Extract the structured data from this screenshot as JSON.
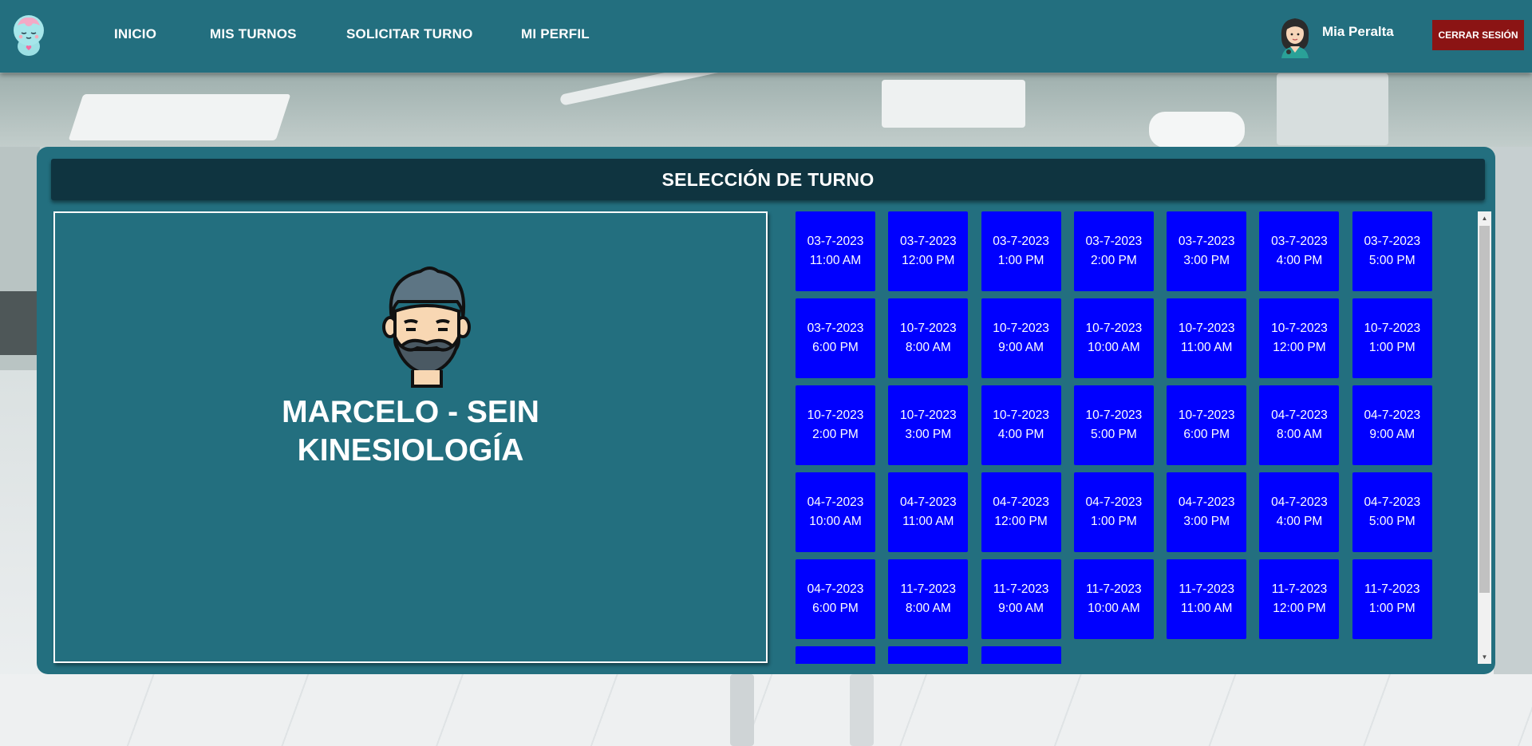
{
  "nav": {
    "links": [
      "INICIO",
      "MIS TURNOS",
      "SOLICITAR TURNO",
      "MI PERFIL"
    ],
    "user_name": "Mia Peralta",
    "logout_label": "CERRAR SESIÓN",
    "logo_icon": "brain-mascot-icon",
    "user_icon": "woman-avatar-icon"
  },
  "card": {
    "title": "SELECCIÓN DE TURNO",
    "doctor": {
      "name": "MARCELO - SEIN",
      "specialty": "KINESIOLOGÍA",
      "avatar_icon": "bearded-man-avatar-icon"
    },
    "slots": [
      {
        "date": "03-7-2023",
        "time": "11:00 AM"
      },
      {
        "date": "03-7-2023",
        "time": "12:00 PM"
      },
      {
        "date": "03-7-2023",
        "time": "1:00 PM"
      },
      {
        "date": "03-7-2023",
        "time": "2:00 PM"
      },
      {
        "date": "03-7-2023",
        "time": "3:00 PM"
      },
      {
        "date": "03-7-2023",
        "time": "4:00 PM"
      },
      {
        "date": "03-7-2023",
        "time": "5:00 PM"
      },
      {
        "date": "03-7-2023",
        "time": "6:00 PM"
      },
      {
        "date": "10-7-2023",
        "time": "8:00 AM"
      },
      {
        "date": "10-7-2023",
        "time": "9:00 AM"
      },
      {
        "date": "10-7-2023",
        "time": "10:00 AM"
      },
      {
        "date": "10-7-2023",
        "time": "11:00 AM"
      },
      {
        "date": "10-7-2023",
        "time": "12:00 PM"
      },
      {
        "date": "10-7-2023",
        "time": "1:00 PM"
      },
      {
        "date": "10-7-2023",
        "time": "2:00 PM"
      },
      {
        "date": "10-7-2023",
        "time": "3:00 PM"
      },
      {
        "date": "10-7-2023",
        "time": "4:00 PM"
      },
      {
        "date": "10-7-2023",
        "time": "5:00 PM"
      },
      {
        "date": "10-7-2023",
        "time": "6:00 PM"
      },
      {
        "date": "04-7-2023",
        "time": "8:00 AM"
      },
      {
        "date": "04-7-2023",
        "time": "9:00 AM"
      },
      {
        "date": "04-7-2023",
        "time": "10:00 AM"
      },
      {
        "date": "04-7-2023",
        "time": "11:00 AM"
      },
      {
        "date": "04-7-2023",
        "time": "12:00 PM"
      },
      {
        "date": "04-7-2023",
        "time": "1:00 PM"
      },
      {
        "date": "04-7-2023",
        "time": "3:00 PM"
      },
      {
        "date": "04-7-2023",
        "time": "4:00 PM"
      },
      {
        "date": "04-7-2023",
        "time": "5:00 PM"
      },
      {
        "date": "04-7-2023",
        "time": "6:00 PM"
      },
      {
        "date": "11-7-2023",
        "time": "8:00 AM"
      },
      {
        "date": "11-7-2023",
        "time": "9:00 AM"
      },
      {
        "date": "11-7-2023",
        "time": "10:00 AM"
      },
      {
        "date": "11-7-2023",
        "time": "11:00 AM"
      },
      {
        "date": "11-7-2023",
        "time": "12:00 PM"
      },
      {
        "date": "11-7-2023",
        "time": "1:00 PM"
      },
      {
        "date": "",
        "time": ""
      },
      {
        "date": "",
        "time": ""
      },
      {
        "date": "",
        "time": ""
      }
    ]
  },
  "colors": {
    "navbar": "#236f7f",
    "card": "#236f7f",
    "header": "#0f3440",
    "slot": "#0000ff",
    "logout": "#8b1414"
  },
  "scrollbar_position": 0
}
